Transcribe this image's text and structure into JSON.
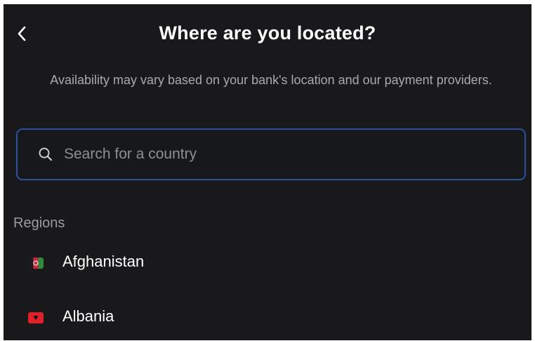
{
  "header": {
    "title": "Where are you located?",
    "back_icon": "chevron-left-icon"
  },
  "subtitle": "Availability may vary based on your bank's location and our payment providers.",
  "search": {
    "placeholder": "Search for a country",
    "value": "",
    "icon": "search-icon"
  },
  "regions": {
    "label": "Regions",
    "items": [
      {
        "name": "Afghanistan",
        "flag": "afghanistan-flag-icon"
      },
      {
        "name": "Albania",
        "flag": "albania-flag-icon"
      }
    ]
  },
  "colors": {
    "background": "#19191b",
    "search_border": "#2c4fa0",
    "subtitle_text": "#a9aab0",
    "placeholder_text": "#8e8f96"
  }
}
